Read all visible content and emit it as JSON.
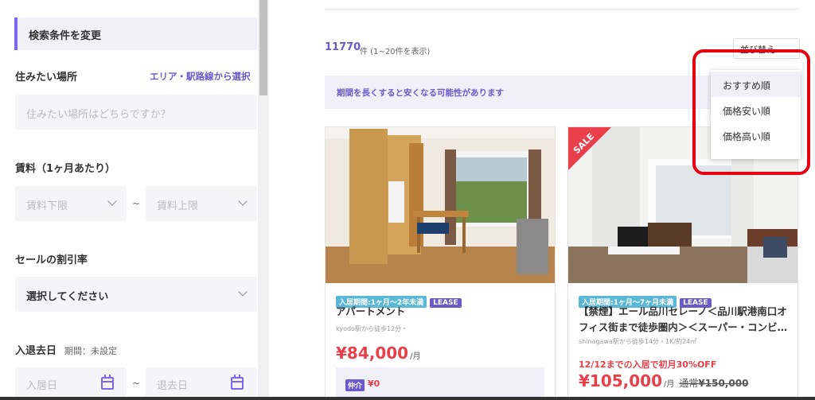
{
  "sidebar": {
    "header": "検索条件を変更",
    "location_label": "住みたい場所",
    "location_link": "エリア・駅路線から選択",
    "location_placeholder": "住みたい場所はどちらですか？",
    "rent_label": "賃料（1ヶ月あたり）",
    "rent_min": "賃料下限",
    "rent_max": "賃料上限",
    "tilde": "~",
    "discount_label": "セールの割引率",
    "discount_value": "選択してください",
    "dates_label": "入退去日",
    "dates_sub": "期間：未設定",
    "move_in": "入居日",
    "move_out": "退去日"
  },
  "results": {
    "count": "11770",
    "count_sub": "件 (1~20件を表示)",
    "sort_label": "並び替え",
    "notice": "期間を長くすると安くなる可能性があります"
  },
  "sort_menu": {
    "items": [
      "おすすめ順",
      "価格安い順",
      "価格高い順"
    ],
    "selected": 0
  },
  "cards": [
    {
      "period_tag": "入居期間:1ヶ月〜2年未満",
      "lease_tag": "LEASE",
      "title": "アパートメント",
      "access": "kyodo駅から徒歩12分・",
      "price": "¥84,000",
      "per": "/月",
      "fee_badge": "仲介",
      "fee_value": "¥0"
    },
    {
      "sale_badge": "SALE",
      "period_tag": "入居期間:1ヶ月〜7ヶ月未満",
      "lease_tag": "LEASE",
      "title": "【禁煙】エール品川セレーノ＜品川駅港南口オフィス街まで徒歩圏内＞＜スーパー・コンビ…",
      "access": "shinagawa駅から徒歩14分・1K/約24㎡",
      "promo": "12/12までの入居で初月30%OFF",
      "price": "¥105,000",
      "per": "/月",
      "regular_label": "通常",
      "regular_price": "¥150,000"
    }
  ],
  "colors": {
    "accent": "#6a5acd",
    "price": "#e83f4a",
    "highlight": "#e60012"
  }
}
